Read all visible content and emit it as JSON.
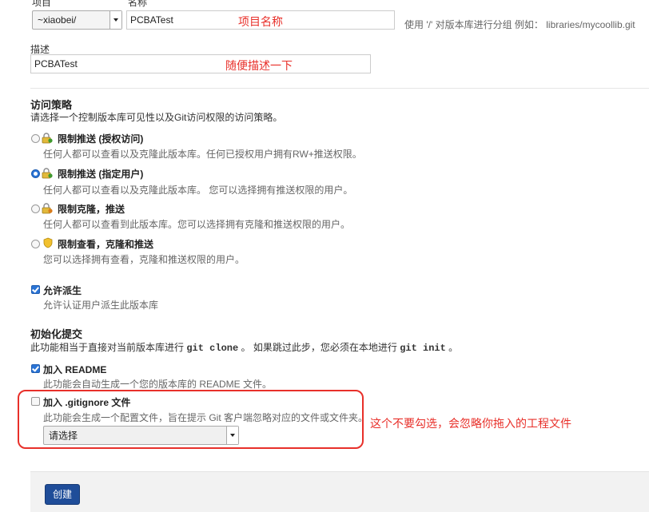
{
  "form": {
    "owner_label": "项目",
    "owner_value": "~xiaobei/",
    "name_label": "名称",
    "name_value": "PCBATest",
    "name_annotation": "项目名称",
    "name_hint": "使用 '/' 对版本库进行分组 例如： libraries/mycoollib.git",
    "desc_label": "描述",
    "desc_value": "PCBATest",
    "desc_annotation": "随便描述一下"
  },
  "access": {
    "heading": "访问策略",
    "intro": "请选择一个控制版本库可见性以及Git访问权限的访问策略。",
    "options": [
      {
        "title": "限制推送 (授权访问)",
        "desc": "任何人都可以查看以及克隆此版本库。任何已授权用户拥有RW+推送权限。",
        "selected": false,
        "icon": "lock-push-icon"
      },
      {
        "title": "限制推送 (指定用户)",
        "desc": "任何人都可以查看以及克隆此版本库。 您可以选择拥有推送权限的用户。",
        "selected": true,
        "icon": "lock-push-users-icon"
      },
      {
        "title": "限制克隆，推送",
        "desc": "任何人都可以查看到此版本库。您可以选择拥有克隆和推送权限的用户。",
        "selected": false,
        "icon": "lock-clone-icon"
      },
      {
        "title": "限制查看，克隆和推送",
        "desc": "您可以选择拥有查看，克隆和推送权限的用户。",
        "selected": false,
        "icon": "shield-icon"
      }
    ]
  },
  "fork": {
    "title": "允许派生",
    "desc": "允许认证用户派生此版本库",
    "checked": true
  },
  "init": {
    "heading": "初始化提交",
    "intro_a": "此功能相当于直接对当前版本库进行",
    "cmd_clone": "git clone",
    "intro_b": "。 如果跳过此步，您必须在本地进行",
    "cmd_init": "git init",
    "intro_c": "。",
    "readme_title": "加入 README",
    "readme_desc": "此功能会自动生成一个您的版本库的 README 文件。",
    "readme_checked": true,
    "gitignore_title": "加入 .gitignore 文件",
    "gitignore_desc": "此功能会生成一个配置文件，旨在提示 Git 客户端忽略对应的文件或文件夹。",
    "gitignore_checked": false,
    "gitignore_select": "请选择",
    "annotation": "这个不要勾选，会忽略你拖入的工程文件"
  },
  "actions": {
    "create_label": "创建"
  },
  "colors": {
    "accent": "#2a74d6",
    "annotation_red": "#e8302a",
    "button_bg": "#1f4d99"
  }
}
